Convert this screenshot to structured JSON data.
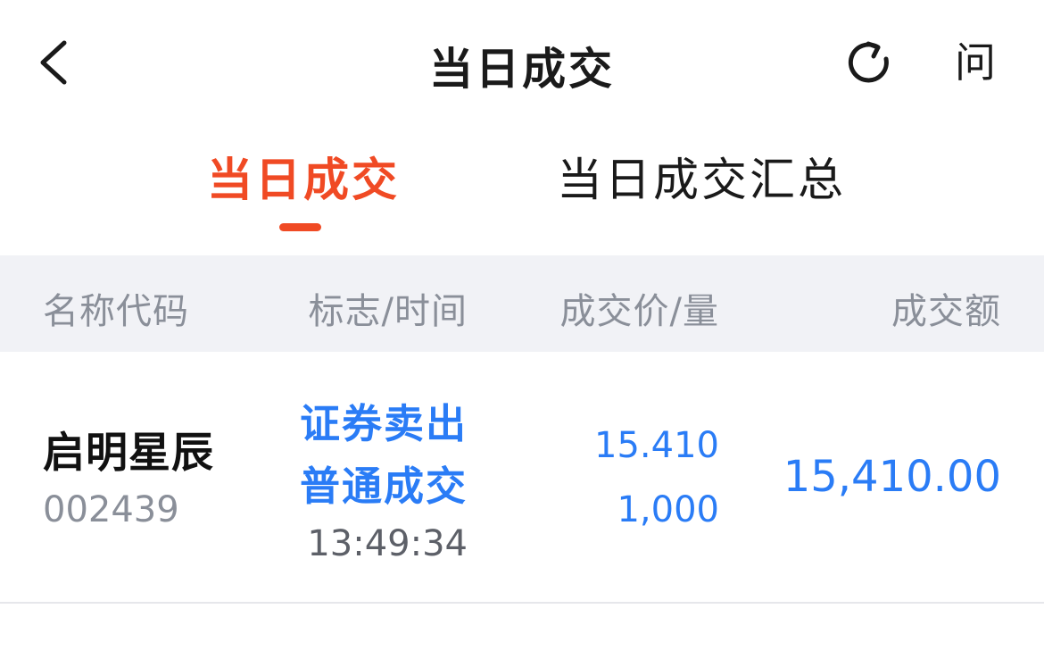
{
  "navbar": {
    "title": "当日成交",
    "back_icon": "chevron-left-icon",
    "refresh_icon": "refresh-icon",
    "help_label": "问"
  },
  "tabs": [
    {
      "label": "当日成交",
      "active": true
    },
    {
      "label": "当日成交汇总",
      "active": false
    }
  ],
  "table": {
    "headers": {
      "name_code": "名称代码",
      "flag_time": "标志/时间",
      "price_qty": "成交价/量",
      "amount": "成交额"
    },
    "rows": [
      {
        "name": "启明星辰",
        "code": "002439",
        "type_line1": "证券卖出",
        "type_line2": "普通成交",
        "time": "13:49:34",
        "price": "15.410",
        "quantity": "1,000",
        "amount": "15,410.00"
      }
    ]
  },
  "colors": {
    "accent": "#f04a24",
    "value_blue": "#2a7cf6",
    "muted_text": "#8a8f99",
    "header_bg": "#f1f2f6"
  }
}
